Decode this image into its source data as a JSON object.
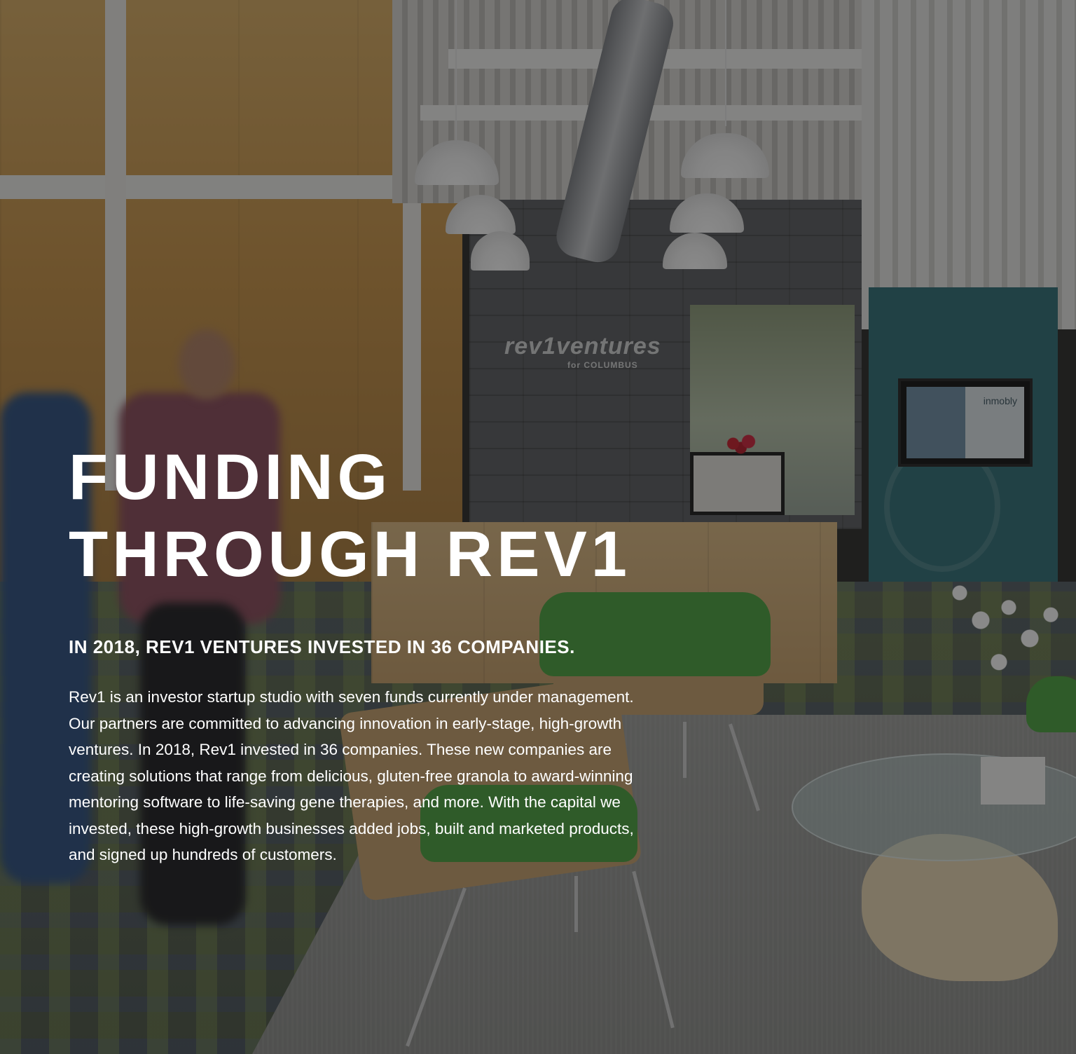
{
  "hero": {
    "title_line1": "FUNDING",
    "title_line2": "THROUGH REV1",
    "subtitle": "IN 2018, REV1 VENTURES INVESTED IN 36 COMPANIES.",
    "body": "Rev1 is an investor startup studio with seven funds currently under management. Our partners are committed to advancing innovation in early-stage, high-growth ventures. In 2018, Rev1 invested in 36 companies. These new companies are creating solutions that range from delicious, gluten-free granola to award-winning mentoring software to life-saving gene therapies, and more. With the capital we invested, these high-growth businesses added jobs, built and marketed products, and signed up hundreds of customers."
  },
  "background": {
    "wall_sign_text": "rev1ventures",
    "wall_sign_subtext": "for COLUMBUS",
    "tv_text": "inmobly"
  },
  "colors": {
    "text": "#ffffff",
    "overlay": "#141414",
    "wood": "#c99346",
    "teal_wall": "#2f6f77",
    "chair_green": "#4aa23f"
  }
}
